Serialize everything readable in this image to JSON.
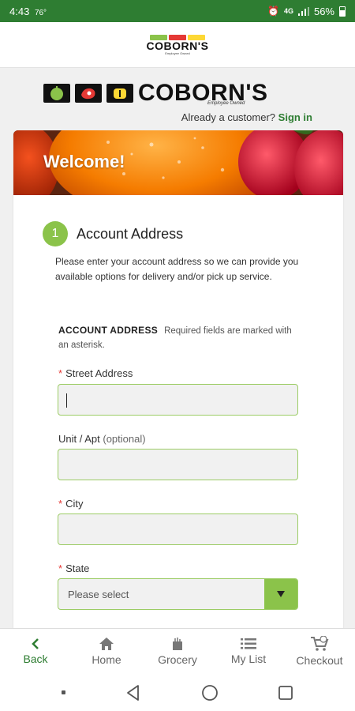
{
  "status": {
    "time": "4:43",
    "extra": "76°",
    "network": "4G",
    "battery": "56%"
  },
  "brand": {
    "name": "COBORN'S",
    "tagline": "Employee Owned"
  },
  "account_prompt": {
    "text": "Already a customer?",
    "link": "Sign in"
  },
  "hero": {
    "title": "Welcome!"
  },
  "step": {
    "number": "1",
    "title": "Account Address"
  },
  "intro": "Please enter your account address so we can provide you available options for delivery and/or pick up service.",
  "section": {
    "heading": "ACCOUNT ADDRESS",
    "note": "Required fields are marked with an asterisk."
  },
  "form": {
    "street": {
      "label": "Street Address",
      "required": "*",
      "value": ""
    },
    "unit": {
      "label": "Unit / Apt",
      "optional": "(optional)",
      "value": ""
    },
    "city": {
      "label": "City",
      "required": "*",
      "value": ""
    },
    "state": {
      "label": "State",
      "required": "*",
      "placeholder": "Please select"
    }
  },
  "nav": [
    {
      "label": "Back",
      "icon": "chevron-left-icon"
    },
    {
      "label": "Home",
      "icon": "home-icon"
    },
    {
      "label": "Grocery",
      "icon": "grocery-bag-icon"
    },
    {
      "label": "My List",
      "icon": "list-icon"
    },
    {
      "label": "Checkout",
      "icon": "cart-icon"
    }
  ],
  "colors": {
    "brand_green": "#2e7d32",
    "accent_green": "#8bc34a",
    "required_red": "#e53935"
  }
}
